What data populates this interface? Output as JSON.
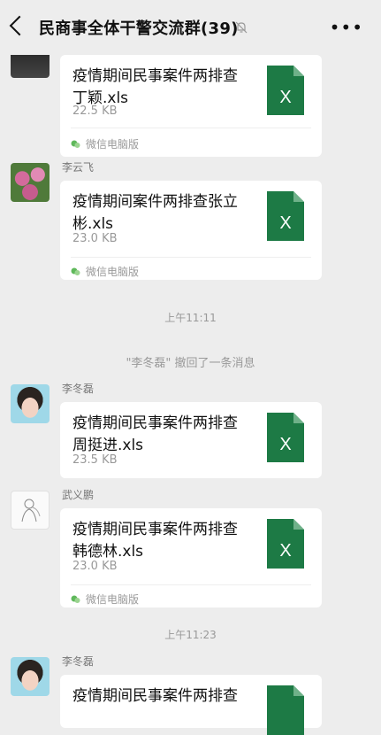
{
  "header": {
    "title": "民商事全体干警交流群(39)",
    "back_icon": "chevron-left-icon",
    "mute_icon": "bell-off-icon",
    "more_label": "•••"
  },
  "messages": [
    {
      "sender": "",
      "file_name": "疫情期间民事案件两排查丁颖.xls",
      "file_size": "22.5 KB",
      "source": "微信电脑版"
    },
    {
      "sender": "李云飞",
      "file_name": "疫情期间案件两排查张立彬.xls",
      "file_size": "23.0 KB",
      "source": "微信电脑版"
    },
    {
      "sender": "李冬磊",
      "file_name": "疫情期间民事案件两排查周挺进.xls",
      "file_size": "23.5 KB",
      "source": ""
    },
    {
      "sender": "武义鹏",
      "file_name": "疫情期间民事案件两排查韩德林.xls",
      "file_size": "23.0 KB",
      "source": "微信电脑版"
    },
    {
      "sender": "李冬磊",
      "file_name": "疫情期间民事案件两排查",
      "file_size": "",
      "source": ""
    }
  ],
  "timestamps": [
    "上午11:11",
    "上午11:23"
  ],
  "recall_notice": "\"李冬磊\" 撤回了一条消息",
  "colors": {
    "excel_green": "#1d7a45",
    "background": "#ededed",
    "card": "#ffffff",
    "source_green": "#5fb85b"
  }
}
